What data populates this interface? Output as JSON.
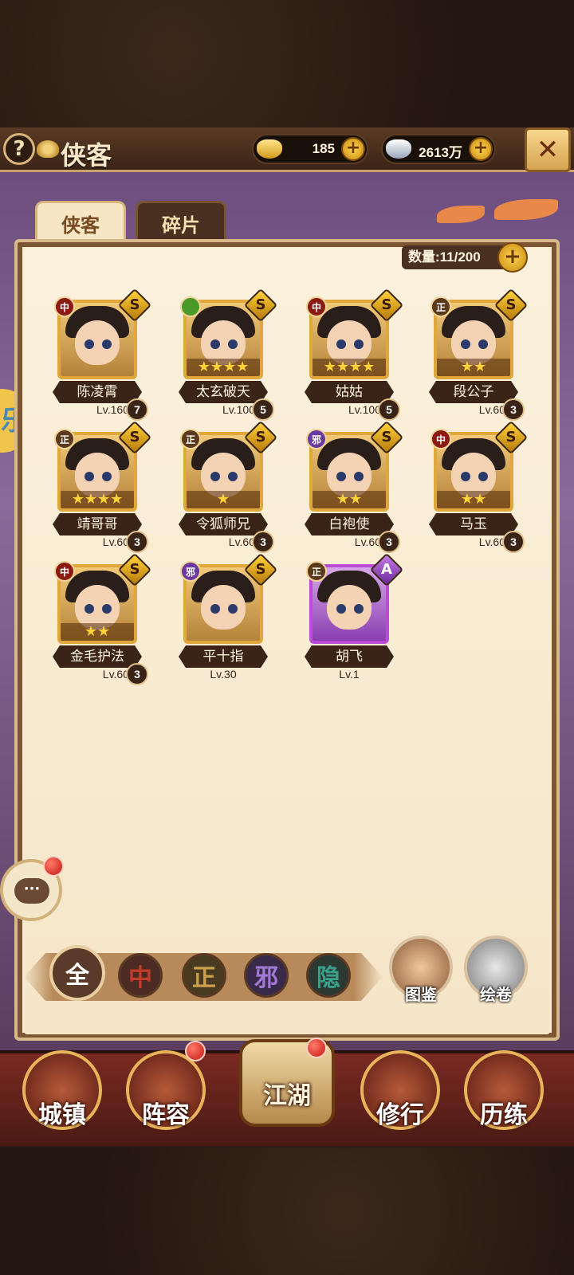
{
  "header": {
    "title": "侠客",
    "help_label": "?",
    "gold": "185",
    "silver": "2613万",
    "plus": "+",
    "close": "✕"
  },
  "tabs": [
    {
      "label": "侠客",
      "active": true
    },
    {
      "label": "碎片",
      "active": false
    }
  ],
  "capacity": "数量:11/200",
  "heroes": [
    {
      "name": "陈凌霄",
      "level": "Lv.160",
      "count": "7",
      "faction": "中",
      "rank": "S",
      "stars": "",
      "border": "gold"
    },
    {
      "name": "太玄破天",
      "level": "Lv.100",
      "count": "5",
      "faction": "",
      "rank": "S",
      "stars": "★★★★",
      "border": "gold"
    },
    {
      "name": "姑姑",
      "level": "Lv.100",
      "count": "5",
      "faction": "中",
      "rank": "S",
      "stars": "★★★★",
      "border": "gold"
    },
    {
      "name": "段公子",
      "level": "Lv.60",
      "count": "3",
      "faction": "正",
      "rank": "S",
      "stars": "★★",
      "border": "gold"
    },
    {
      "name": "靖哥哥",
      "level": "Lv.60",
      "count": "3",
      "faction": "正",
      "rank": "S",
      "stars": "★★★★",
      "border": "gold"
    },
    {
      "name": "令狐师兄",
      "level": "Lv.60",
      "count": "3",
      "faction": "正",
      "rank": "S",
      "stars": "★",
      "border": "gold"
    },
    {
      "name": "白袍使",
      "level": "Lv.60",
      "count": "3",
      "faction": "邪",
      "rank": "S",
      "stars": "★★",
      "border": "gold"
    },
    {
      "name": "马玉",
      "level": "Lv.60",
      "count": "3",
      "faction": "中",
      "rank": "S",
      "stars": "★★",
      "border": "gold"
    },
    {
      "name": "金毛护法",
      "level": "Lv.60",
      "count": "3",
      "faction": "中",
      "rank": "S",
      "stars": "★★",
      "border": "gold"
    },
    {
      "name": "平十指",
      "level": "Lv.30",
      "count": "",
      "faction": "邪",
      "rank": "S",
      "stars": "",
      "border": "gold"
    },
    {
      "name": "胡飞",
      "level": "Lv.1",
      "count": "",
      "faction": "正",
      "rank": "A",
      "stars": "",
      "border": "purple"
    }
  ],
  "filters": [
    "全",
    "中",
    "正",
    "邪",
    "隐"
  ],
  "side_buttons": {
    "tujian": "图鉴",
    "huijuan": "绘卷"
  },
  "chat": "···",
  "side_gold_text": "乐",
  "nav": [
    "城镇",
    "阵容",
    "江湖",
    "修行",
    "历练"
  ]
}
